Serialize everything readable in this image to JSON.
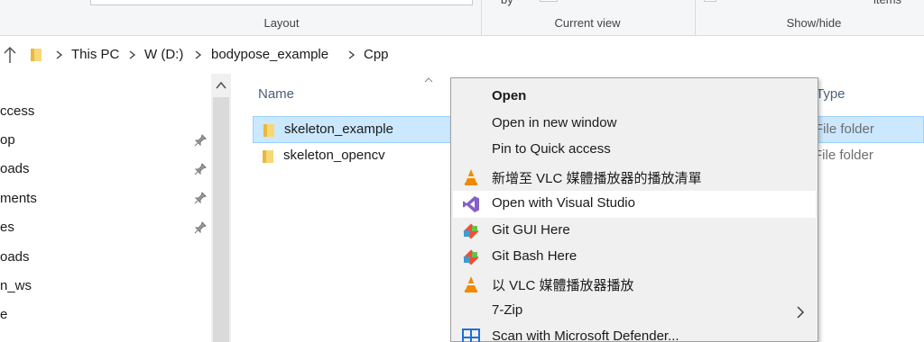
{
  "ribbon": {
    "groups": [
      {
        "label": "Layout"
      },
      {
        "label": "Current view"
      },
      {
        "label": "Show/hide"
      }
    ],
    "partial_by": "by",
    "partial_items": "items"
  },
  "address": {
    "crumbs": [
      "This PC",
      "W (D:)",
      "bodypose_example",
      "Cpp"
    ]
  },
  "nav": {
    "items": [
      {
        "label": "ccess",
        "pinned": false
      },
      {
        "label": "op",
        "pinned": true
      },
      {
        "label": "oads",
        "pinned": true
      },
      {
        "label": "ments",
        "pinned": true
      },
      {
        "label": "es",
        "pinned": true
      },
      {
        "label": "oads",
        "pinned": false
      },
      {
        "label": "n_ws",
        "pinned": false
      },
      {
        "label": "e",
        "pinned": false
      }
    ]
  },
  "content": {
    "columns": {
      "name": "Name",
      "type": "Type"
    },
    "rows": [
      {
        "name": "skeleton_example",
        "type": "File folder",
        "selected": true
      },
      {
        "name": "skeleton_opencv",
        "type": "File folder",
        "selected": false
      }
    ]
  },
  "menu": {
    "items": [
      {
        "label": "Open",
        "icon": "none",
        "bold": true
      },
      {
        "label": "Open in new window",
        "icon": "none"
      },
      {
        "label": "Pin to Quick access",
        "icon": "none"
      },
      {
        "label": "新增至 VLC 媒體播放器的播放清單",
        "icon": "vlc-icon"
      },
      {
        "label": "Open with Visual Studio",
        "icon": "visual-studio-icon",
        "hover": true
      },
      {
        "label": "Git GUI Here",
        "icon": "git-icon"
      },
      {
        "label": "Git Bash Here",
        "icon": "git-icon"
      },
      {
        "label": "以 VLC 媒體播放器播放",
        "icon": "vlc-icon"
      },
      {
        "label": "7-Zip",
        "icon": "none",
        "submenu": true
      },
      {
        "label": "Scan with Microsoft Defender...",
        "icon": "defender-icon"
      }
    ]
  },
  "colors": {
    "selection": "#cce8ff",
    "menu_bg": "#f0f0f0",
    "folder": "#f8d775"
  }
}
